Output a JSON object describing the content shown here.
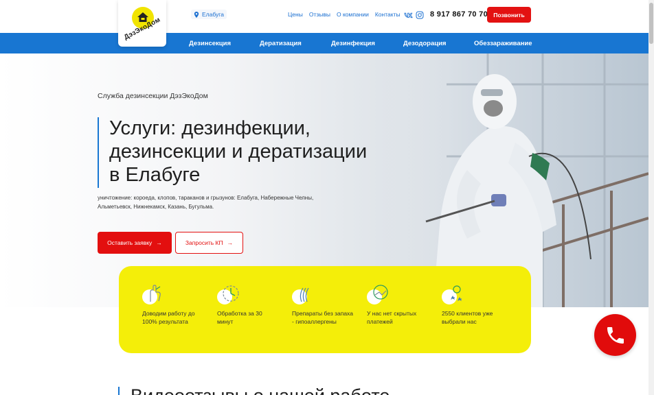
{
  "header": {
    "logo_text": "ДэзЭкоДом",
    "city": "Елабуга",
    "nav": [
      "Цены",
      "Отзывы",
      "О компании",
      "Контакты"
    ],
    "phone": "8 917 867 70 70",
    "call_button": "Позвонить"
  },
  "mainnav": [
    "Дезинсекция",
    "Дератизация",
    "Дезинфекция",
    "Дезодорация",
    "Обеззараживание"
  ],
  "hero": {
    "subtitle": "Служба дезинсекции ДэзЭкоДом",
    "title_lines": [
      "Услуги: дезинфекции,",
      "дезинсекции и дератизации",
      "в Елабуге"
    ],
    "description_lines": [
      "уничтожение: короеда, клопов, тараканов и грызунов: Елабуга, Набережные Челны,",
      "Альметьевск, Нижнекамск, Казань, Бугульма."
    ],
    "btn_primary": "Оставить заявку",
    "btn_secondary": "Запросить КП"
  },
  "features": [
    {
      "icon": "hand-ok-icon",
      "text": "Доводим работу до 100% результата"
    },
    {
      "icon": "timer-icon",
      "text": "Обработка за 30 минут"
    },
    {
      "icon": "wave-icon",
      "text": "Препараты без запаха - гипоаллергены"
    },
    {
      "icon": "handshake-icon",
      "text": "У нас нет скрытых платежей"
    },
    {
      "icon": "clients-icon",
      "text": "2550 клиентов уже выбрали нас"
    }
  ],
  "section2": {
    "title": "Видеоотзывы о нашей работе"
  },
  "colors": {
    "accent_blue": "#1876d2",
    "accent_red": "#e30f0f",
    "yellow": "#f4ee09"
  }
}
